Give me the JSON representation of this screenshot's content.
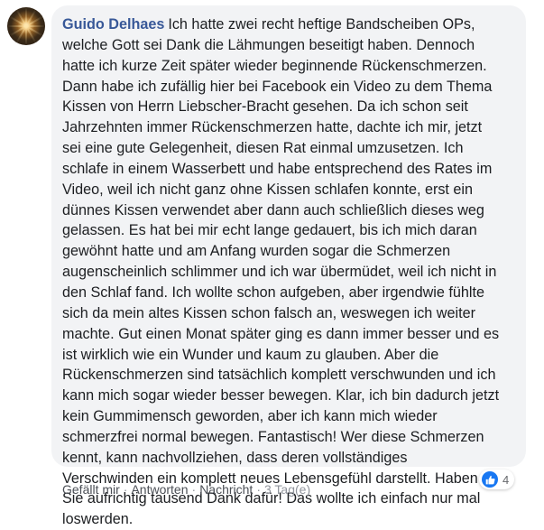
{
  "comment": {
    "author": "Guido Delhaes",
    "lines": [
      "Ich hatte zwei recht heftige Bandscheiben OPs,",
      "welche Gott sei Dank die Lähmungen beseitigt haben. Dennoch",
      "hatte ich kurze Zeit später wieder beginnende Rückenschmerzen.",
      "Dann habe ich zufällig hier bei Facebook ein Video zu dem Thema",
      "Kissen von Herrn Liebscher-Bracht gesehen. Da ich schon seit",
      "Jahrzehnten immer Rückenschmerzen hatte, dachte ich mir, jetzt",
      "sei eine gute Gelegenheit, diesen Rat einmal umzusetzen. Ich",
      "schlafe in einem Wasserbett und habe entsprechend des Rates im",
      "Video, weil ich nicht ganz ohne Kissen schlafen konnte, erst ein",
      "dünnes Kissen verwendet aber dann auch schließlich dieses weg",
      "gelassen. Es hat bei mir echt lange gedauert, bis ich mich daran",
      "gewöhnt hatte und am Anfang wurden sogar die Schmerzen",
      "augenscheinlich schlimmer und ich war übermüdet, weil ich nicht in",
      "den Schlaf fand. Ich wollte schon aufgeben, aber irgendwie fühlte",
      "sich da mein altes Kissen schon falsch an, weswegen ich weiter",
      "machte. Gut einen Monat später ging es dann immer besser und es",
      "ist wirklich wie ein Wunder und kaum zu glauben. Aber die",
      "Rückenschmerzen sind tatsächlich komplett verschwunden und ich",
      "kann mich sogar wieder besser bewegen. Klar, ich bin dadurch jetzt",
      "kein Gummimensch geworden, aber ich kann mich wieder",
      "schmerzfrei normal bewegen. Fantastisch! Wer diese Schmerzen",
      "kennt, kann nachvollziehen, dass deren vollständiges",
      "Verschwinden ein komplett neues Lebensgefühl darstellt. Haben",
      "Sie aufrichtig tausend Dank dafür! Das wollte ich einfach nur mal",
      "loswerden."
    ]
  },
  "reactions": {
    "icon": "thumbs-up-icon",
    "count": "4",
    "color": "#1877f2"
  },
  "actions": {
    "like": "Gefällt mir",
    "reply": "Antworten",
    "message": "Nachricht",
    "separator": "·",
    "time": "3 Tag(e)"
  },
  "colors": {
    "author": "#385898",
    "bubble": "#f2f3f5",
    "text": "#1c1e21"
  }
}
